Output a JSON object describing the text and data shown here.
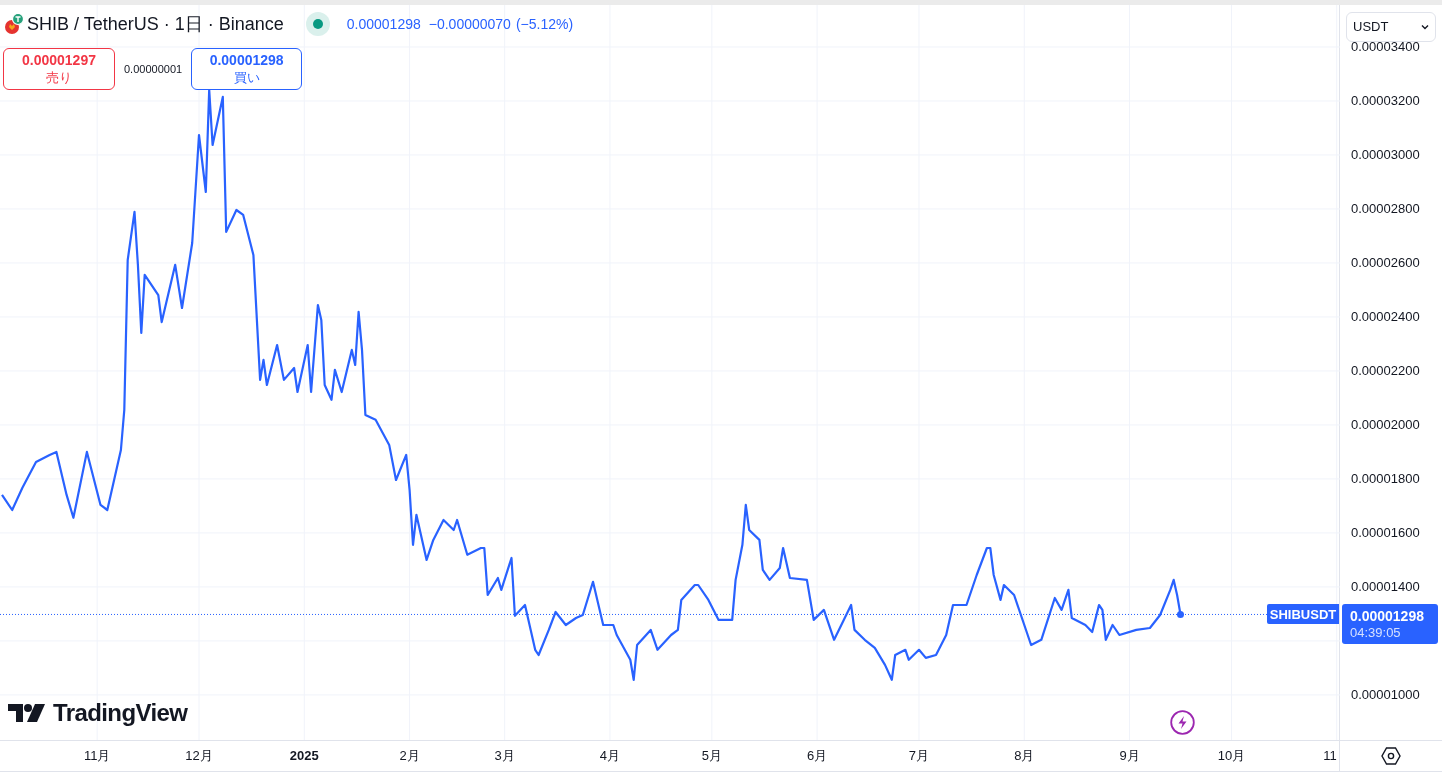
{
  "header": {
    "title": "SHIB / TetherUS · 1日 · Binance",
    "last": "0.00001298",
    "change": "−0.00000070",
    "change_pct": "(−5.12%)"
  },
  "trade": {
    "sell_price": "0.00001297",
    "sell_label": "売り",
    "spread": "0.00000001",
    "buy_price": "0.00001298",
    "buy_label": "買い"
  },
  "currency_select": {
    "value": "USDT"
  },
  "price_axis": {
    "last_price": "0.00001298",
    "countdown": "04:39:05"
  },
  "brand": "TradingView",
  "chart_data": {
    "type": "line",
    "grid": true,
    "xlim": [
      "2024-10-04",
      "2025-12-02"
    ],
    "ylim": [
      8.33e-06,
      3.574e-05
    ],
    "x": [
      "2024-10-04",
      "2024-10-07",
      "2024-10-10",
      "2024-10-14",
      "2024-10-18",
      "2024-10-20",
      "2024-10-23",
      "2024-10-25",
      "2024-10-29",
      "2024-11-02",
      "2024-11-04",
      "2024-11-08",
      "2024-11-09",
      "2024-11-10",
      "2024-11-12",
      "2024-11-13",
      "2024-11-14",
      "2024-11-15",
      "2024-11-19",
      "2024-11-20",
      "2024-11-24",
      "2024-11-26",
      "2024-11-29",
      "2024-12-01",
      "2024-12-03",
      "2024-12-04",
      "2024-12-05",
      "2024-12-08",
      "2024-12-09",
      "2024-12-12",
      "2024-12-14",
      "2024-12-17",
      "2024-12-19",
      "2024-12-20",
      "2024-12-21",
      "2024-12-24",
      "2024-12-26",
      "2024-12-29",
      "2024-12-30",
      "2025-01-02",
      "2025-01-03",
      "2025-01-05",
      "2025-01-06",
      "2025-01-07",
      "2025-01-09",
      "2025-01-10",
      "2025-01-12",
      "2025-01-15",
      "2025-01-16",
      "2025-01-17",
      "2025-01-18",
      "2025-01-19",
      "2025-01-22",
      "2025-01-26",
      "2025-01-28",
      "2025-01-31",
      "2025-02-01",
      "2025-02-02",
      "2025-02-03",
      "2025-02-06",
      "2025-02-08",
      "2025-02-11",
      "2025-02-14",
      "2025-02-15",
      "2025-02-18",
      "2025-02-22",
      "2025-02-23",
      "2025-02-24",
      "2025-02-27",
      "2025-02-28",
      "2025-03-03",
      "2025-03-04",
      "2025-03-07",
      "2025-03-10",
      "2025-03-11",
      "2025-03-14",
      "2025-03-16",
      "2025-03-19",
      "2025-03-22",
      "2025-03-24",
      "2025-03-27",
      "2025-03-30",
      "2025-04-02",
      "2025-04-03",
      "2025-04-07",
      "2025-04-08",
      "2025-04-09",
      "2025-04-13",
      "2025-04-15",
      "2025-04-19",
      "2025-04-21",
      "2025-04-22",
      "2025-04-26",
      "2025-04-27",
      "2025-04-30",
      "2025-05-03",
      "2025-05-07",
      "2025-05-08",
      "2025-05-10",
      "2025-05-11",
      "2025-05-12",
      "2025-05-15",
      "2025-05-16",
      "2025-05-18",
      "2025-05-21",
      "2025-05-22",
      "2025-05-24",
      "2025-05-29",
      "2025-05-31",
      "2025-06-03",
      "2025-06-06",
      "2025-06-11",
      "2025-06-12",
      "2025-06-15",
      "2025-06-18",
      "2025-06-21",
      "2025-06-23",
      "2025-06-24",
      "2025-06-27",
      "2025-06-28",
      "2025-07-01",
      "2025-07-03",
      "2025-07-06",
      "2025-07-09",
      "2025-07-11",
      "2025-07-15",
      "2025-07-18",
      "2025-07-21",
      "2025-07-22",
      "2025-07-23",
      "2025-07-25",
      "2025-07-26",
      "2025-07-29",
      "2025-08-02",
      "2025-08-03",
      "2025-08-06",
      "2025-08-10",
      "2025-08-12",
      "2025-08-14",
      "2025-08-15",
      "2025-08-19",
      "2025-08-21",
      "2025-08-23",
      "2025-08-24",
      "2025-08-25",
      "2025-08-27",
      "2025-08-29",
      "2025-09-03",
      "2025-09-07",
      "2025-09-10",
      "2025-09-13",
      "2025-09-14",
      "2025-09-15",
      "2025-09-16"
    ],
    "series": [
      {
        "name": "SHIBUSDT",
        "color": "#2962ff",
        "values": [
          1.741e-05,
          1.685e-05,
          1.767e-05,
          1.863e-05,
          1.889e-05,
          1.9e-05,
          1.741e-05,
          1.656e-05,
          1.9e-05,
          1.704e-05,
          1.685e-05,
          1.907e-05,
          2.056e-05,
          2.611e-05,
          2.789e-05,
          2.593e-05,
          2.341e-05,
          2.556e-05,
          2.481e-05,
          2.381e-05,
          2.593e-05,
          2.433e-05,
          2.674e-05,
          3.074e-05,
          2.863e-05,
          3.241e-05,
          3.037e-05,
          3.215e-05,
          2.715e-05,
          2.796e-05,
          2.778e-05,
          2.63e-05,
          2.167e-05,
          2.241e-05,
          2.148e-05,
          2.296e-05,
          2.167e-05,
          2.211e-05,
          2.122e-05,
          2.296e-05,
          2.122e-05,
          2.444e-05,
          2.389e-05,
          2.148e-05,
          2.093e-05,
          2.204e-05,
          2.122e-05,
          2.278e-05,
          2.222e-05,
          2.419e-05,
          2.278e-05,
          2.037e-05,
          2.019e-05,
          1.926e-05,
          1.796e-05,
          1.889e-05,
          1.759e-05,
          1.556e-05,
          1.667e-05,
          1.5e-05,
          1.574e-05,
          1.648e-05,
          1.611e-05,
          1.648e-05,
          1.519e-05,
          1.544e-05,
          1.544e-05,
          1.37e-05,
          1.433e-05,
          1.389e-05,
          1.507e-05,
          1.293e-05,
          1.333e-05,
          1.167e-05,
          1.148e-05,
          1.241e-05,
          1.307e-05,
          1.259e-05,
          1.285e-05,
          1.296e-05,
          1.419e-05,
          1.259e-05,
          1.259e-05,
          1.222e-05,
          1.13e-05,
          1.056e-05,
          1.185e-05,
          1.241e-05,
          1.167e-05,
          1.222e-05,
          1.241e-05,
          1.352e-05,
          1.407e-05,
          1.407e-05,
          1.352e-05,
          1.278e-05,
          1.278e-05,
          1.426e-05,
          1.556e-05,
          1.704e-05,
          1.611e-05,
          1.574e-05,
          1.463e-05,
          1.426e-05,
          1.47e-05,
          1.544e-05,
          1.433e-05,
          1.426e-05,
          1.278e-05,
          1.315e-05,
          1.204e-05,
          1.333e-05,
          1.241e-05,
          1.204e-05,
          1.174e-05,
          1.111e-05,
          1.056e-05,
          1.148e-05,
          1.167e-05,
          1.13e-05,
          1.167e-05,
          1.137e-05,
          1.148e-05,
          1.222e-05,
          1.333e-05,
          1.333e-05,
          1.444e-05,
          1.544e-05,
          1.544e-05,
          1.444e-05,
          1.352e-05,
          1.407e-05,
          1.37e-05,
          1.222e-05,
          1.185e-05,
          1.204e-05,
          1.359e-05,
          1.315e-05,
          1.389e-05,
          1.285e-05,
          1.259e-05,
          1.233e-05,
          1.333e-05,
          1.315e-05,
          1.204e-05,
          1.259e-05,
          1.222e-05,
          1.241e-05,
          1.248e-05,
          1.296e-05,
          1.389e-05,
          1.426e-05,
          1.37e-05,
          1.298e-05
        ]
      }
    ],
    "yticks": [
      {
        "value": 1e-05,
        "label": "0.00001000"
      },
      {
        "value": 1.4e-05,
        "label": "0.00001400"
      },
      {
        "value": 1.6e-05,
        "label": "0.00001600"
      },
      {
        "value": 1.8e-05,
        "label": "0.00001800"
      },
      {
        "value": 2e-05,
        "label": "0.00002000"
      },
      {
        "value": 2.2e-05,
        "label": "0.00002200"
      },
      {
        "value": 2.4e-05,
        "label": "0.00002400"
      },
      {
        "value": 2.6e-05,
        "label": "0.00002600"
      },
      {
        "value": 2.8e-05,
        "label": "0.00002800"
      },
      {
        "value": 3e-05,
        "label": "0.00003000"
      },
      {
        "value": 3.2e-05,
        "label": "0.00003200"
      },
      {
        "value": 3.4e-05,
        "label": "0.00003400"
      }
    ],
    "xticks": [
      {
        "value": "2024-11-01",
        "label": "11月"
      },
      {
        "value": "2024-12-01",
        "label": "12月"
      },
      {
        "value": "2025-01-01",
        "label": "2025"
      },
      {
        "value": "2025-02-01",
        "label": "2月"
      },
      {
        "value": "2025-03-01",
        "label": "3月"
      },
      {
        "value": "2025-04-01",
        "label": "4月"
      },
      {
        "value": "2025-05-01",
        "label": "5月"
      },
      {
        "value": "2025-06-01",
        "label": "6月"
      },
      {
        "value": "2025-07-01",
        "label": "7月"
      },
      {
        "value": "2025-08-01",
        "label": "8月"
      },
      {
        "value": "2025-09-01",
        "label": "9月"
      },
      {
        "value": "2025-10-01",
        "label": "10月"
      },
      {
        "value": "2025-11-01",
        "label": "11"
      }
    ]
  }
}
